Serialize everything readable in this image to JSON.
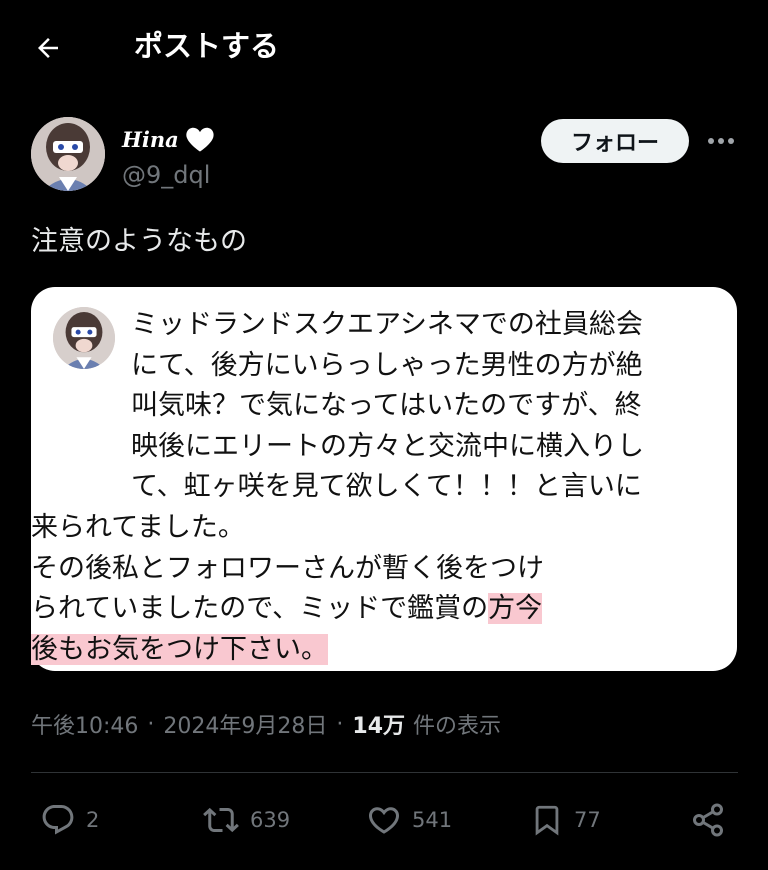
{
  "header": {
    "title": "ポストする",
    "back_icon": "arrow-left-icon"
  },
  "author": {
    "display_name": "𝒽𝒾𝓃𝒶",
    "display_name_visible": "Hina",
    "heart_emoji": "🤍",
    "handle": "@9_dql",
    "follow_label": "フォロー"
  },
  "post": {
    "text": "注意のようなもの"
  },
  "card": {
    "lines": [
      "ミッドランドスクエアシネマでの社員総会",
      "にて、後方にいらっしゃった男性の方が絶",
      "叫気味？で気になってはいたのですが、終",
      "映後にエリートの方々と交流中に横入りし",
      "て、虹ヶ咲を見て欲しくて！！！と言いに",
      "来られてました。",
      "その後私とフォロワーさんが暫く後をつけ"
    ],
    "line8_pre": "られていましたので、ミッドで鑑賞の",
    "line8_hl": "方今",
    "line9_hl": "後もお気をつけ下さい。"
  },
  "meta": {
    "time": "午後10:46",
    "date": "2024年9月28日",
    "views_count": "14万",
    "views_label": "件の表示",
    "separator": "·"
  },
  "actions": {
    "replies": "2",
    "reposts": "639",
    "likes": "541",
    "bookmarks": "77"
  },
  "colors": {
    "background": "#000000",
    "text": "#e7e9ea",
    "muted": "#71767b",
    "highlight": "#f9c8d0",
    "follow_bg": "#eff3f4"
  }
}
